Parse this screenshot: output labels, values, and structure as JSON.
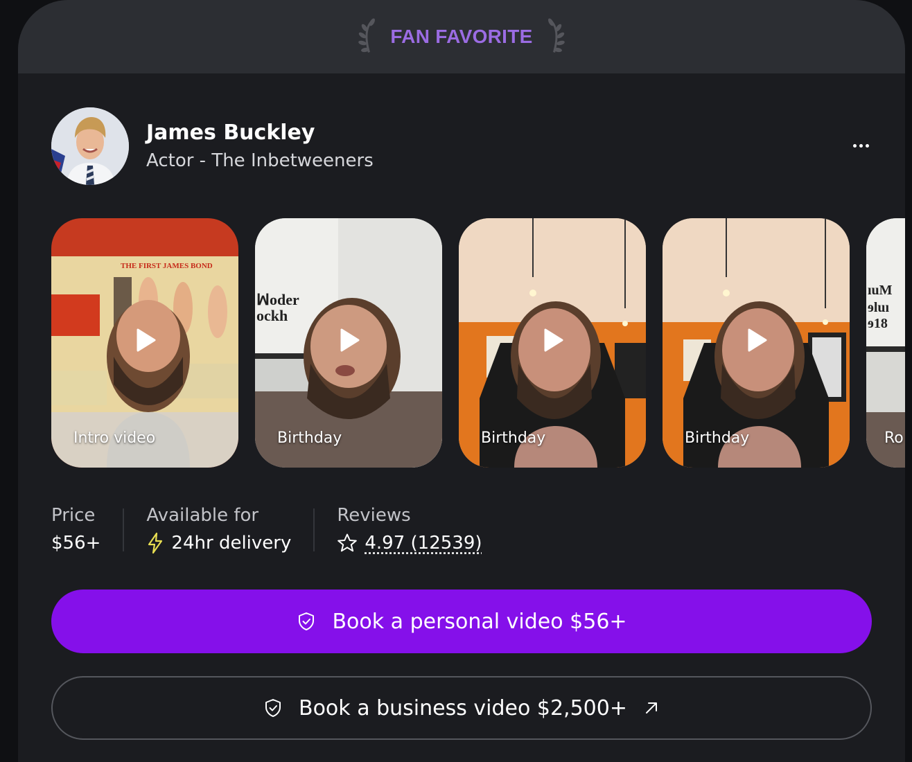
{
  "banner": {
    "title": "FAN FAVORITE"
  },
  "profile": {
    "name": "James Buckley",
    "subtitle": "Actor - The Inbetweeners"
  },
  "videos": [
    {
      "label": "Intro video"
    },
    {
      "label": "Birthday"
    },
    {
      "label": "Birthday"
    },
    {
      "label": "Birthday"
    },
    {
      "label": "Ro"
    }
  ],
  "stats": {
    "price": {
      "label": "Price",
      "value": "$56+"
    },
    "availability": {
      "label": "Available for",
      "value": "24hr delivery"
    },
    "reviews": {
      "label": "Reviews",
      "value": "4.97 (12539)"
    }
  },
  "actions": {
    "personal": "Book a personal video $56+",
    "business": "Book a business video $2,500+"
  },
  "colors": {
    "accent": "#8510ea",
    "banner_text": "#9b6ce3",
    "lightning": "#e8de52",
    "card_bg": "#1b1c20"
  },
  "icons": {
    "laurel": "laurel-icon",
    "more": "more-options-icon",
    "play": "play-icon",
    "lightning": "lightning-icon",
    "star": "star-icon",
    "shield": "shield-check-icon",
    "external": "arrow-up-right-icon"
  }
}
